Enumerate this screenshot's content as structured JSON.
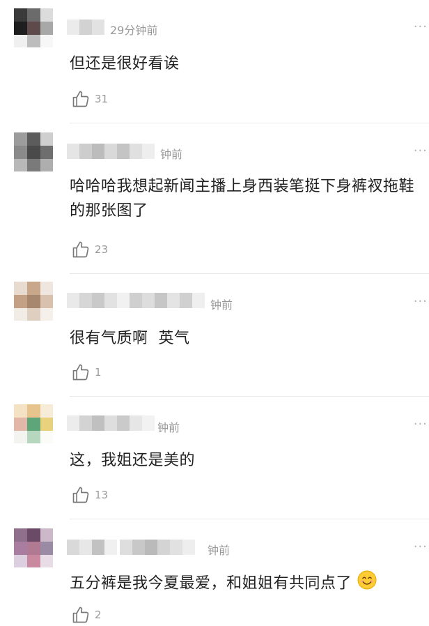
{
  "more_icon": "···",
  "comments": [
    {
      "time": "29分钟前",
      "text": "但还是很好看诶",
      "likes": "31"
    },
    {
      "time": "钟前",
      "text": "哈哈哈我想起新闻主播上身西装笔挺下身裤衩拖鞋的那张图了",
      "likes": "23"
    },
    {
      "time": "钟前",
      "text": "很有气质啊  英气",
      "likes": "1"
    },
    {
      "time": "钟前",
      "text": "这，我姐还是美的",
      "likes": "13"
    },
    {
      "time": "钟前",
      "text": "五分裤是我今夏最爱，和姐姐有共同点了",
      "likes": "2"
    }
  ]
}
